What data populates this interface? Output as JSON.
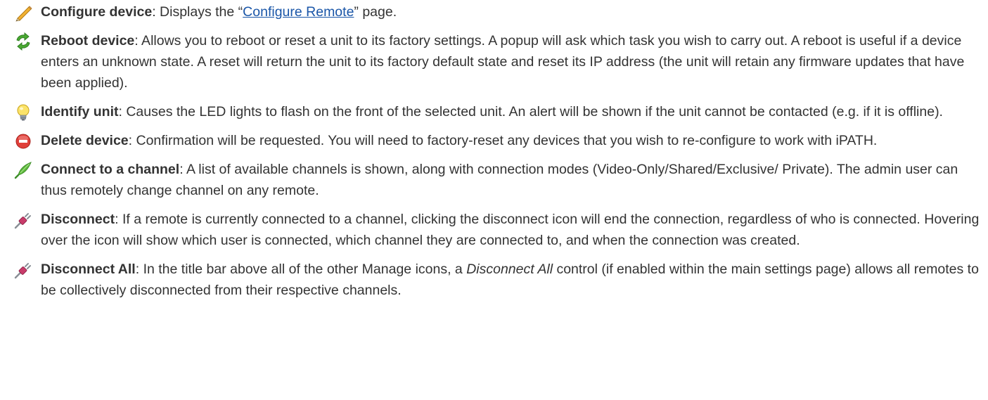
{
  "items": [
    {
      "icon": "pencil-icon",
      "term": "Configure device",
      "text_before_link": ": Displays the “",
      "link": "Configure Remote",
      "text_after_link": "” page."
    },
    {
      "icon": "refresh-arrows-icon",
      "term": "Reboot device",
      "text": ": Allows you to reboot or reset a unit to its factory settings. A popup will ask which task you wish to carry out. A reboot is useful if a device enters an unknown state. A reset will return the unit to its factory default state and reset its IP address (the unit will retain any firmware updates that have been applied)."
    },
    {
      "icon": "lightbulb-icon",
      "term": "Identify unit",
      "text": ": Causes the LED lights to flash on the front of the selected unit. An alert will be shown if the unit cannot be contacted (e.g. if it is offline)."
    },
    {
      "icon": "delete-icon",
      "term": "Delete device",
      "text": ": Confirmation will be requested. You will need to factory-reset any devices that you wish to re-configure to work with iPATH."
    },
    {
      "icon": "connect-plug-icon",
      "term": "Connect to a channel",
      "text": ": A list of available channels is shown, along with connection modes (Video-Only/Shared/Exclusive/ Private). The admin user can thus remotely change channel on any remote."
    },
    {
      "icon": "disconnect-plug-icon",
      "term": "Disconnect",
      "text": ": If a remote is currently connected to a channel, clicking the disconnect icon will end the connection, regardless of who is connected. Hovering over the icon will show which user is connected, which channel they are connected to, and when the connection was created."
    },
    {
      "icon": "disconnect-all-icon",
      "term": "Disconnect All",
      "text_before_em": ": In the title bar above all of the other Manage icons, a ",
      "em": "Disconnect All",
      "text_after_em": " control (if enabled within the main settings page) allows all remotes to be collectively disconnected from their respective channels."
    }
  ]
}
